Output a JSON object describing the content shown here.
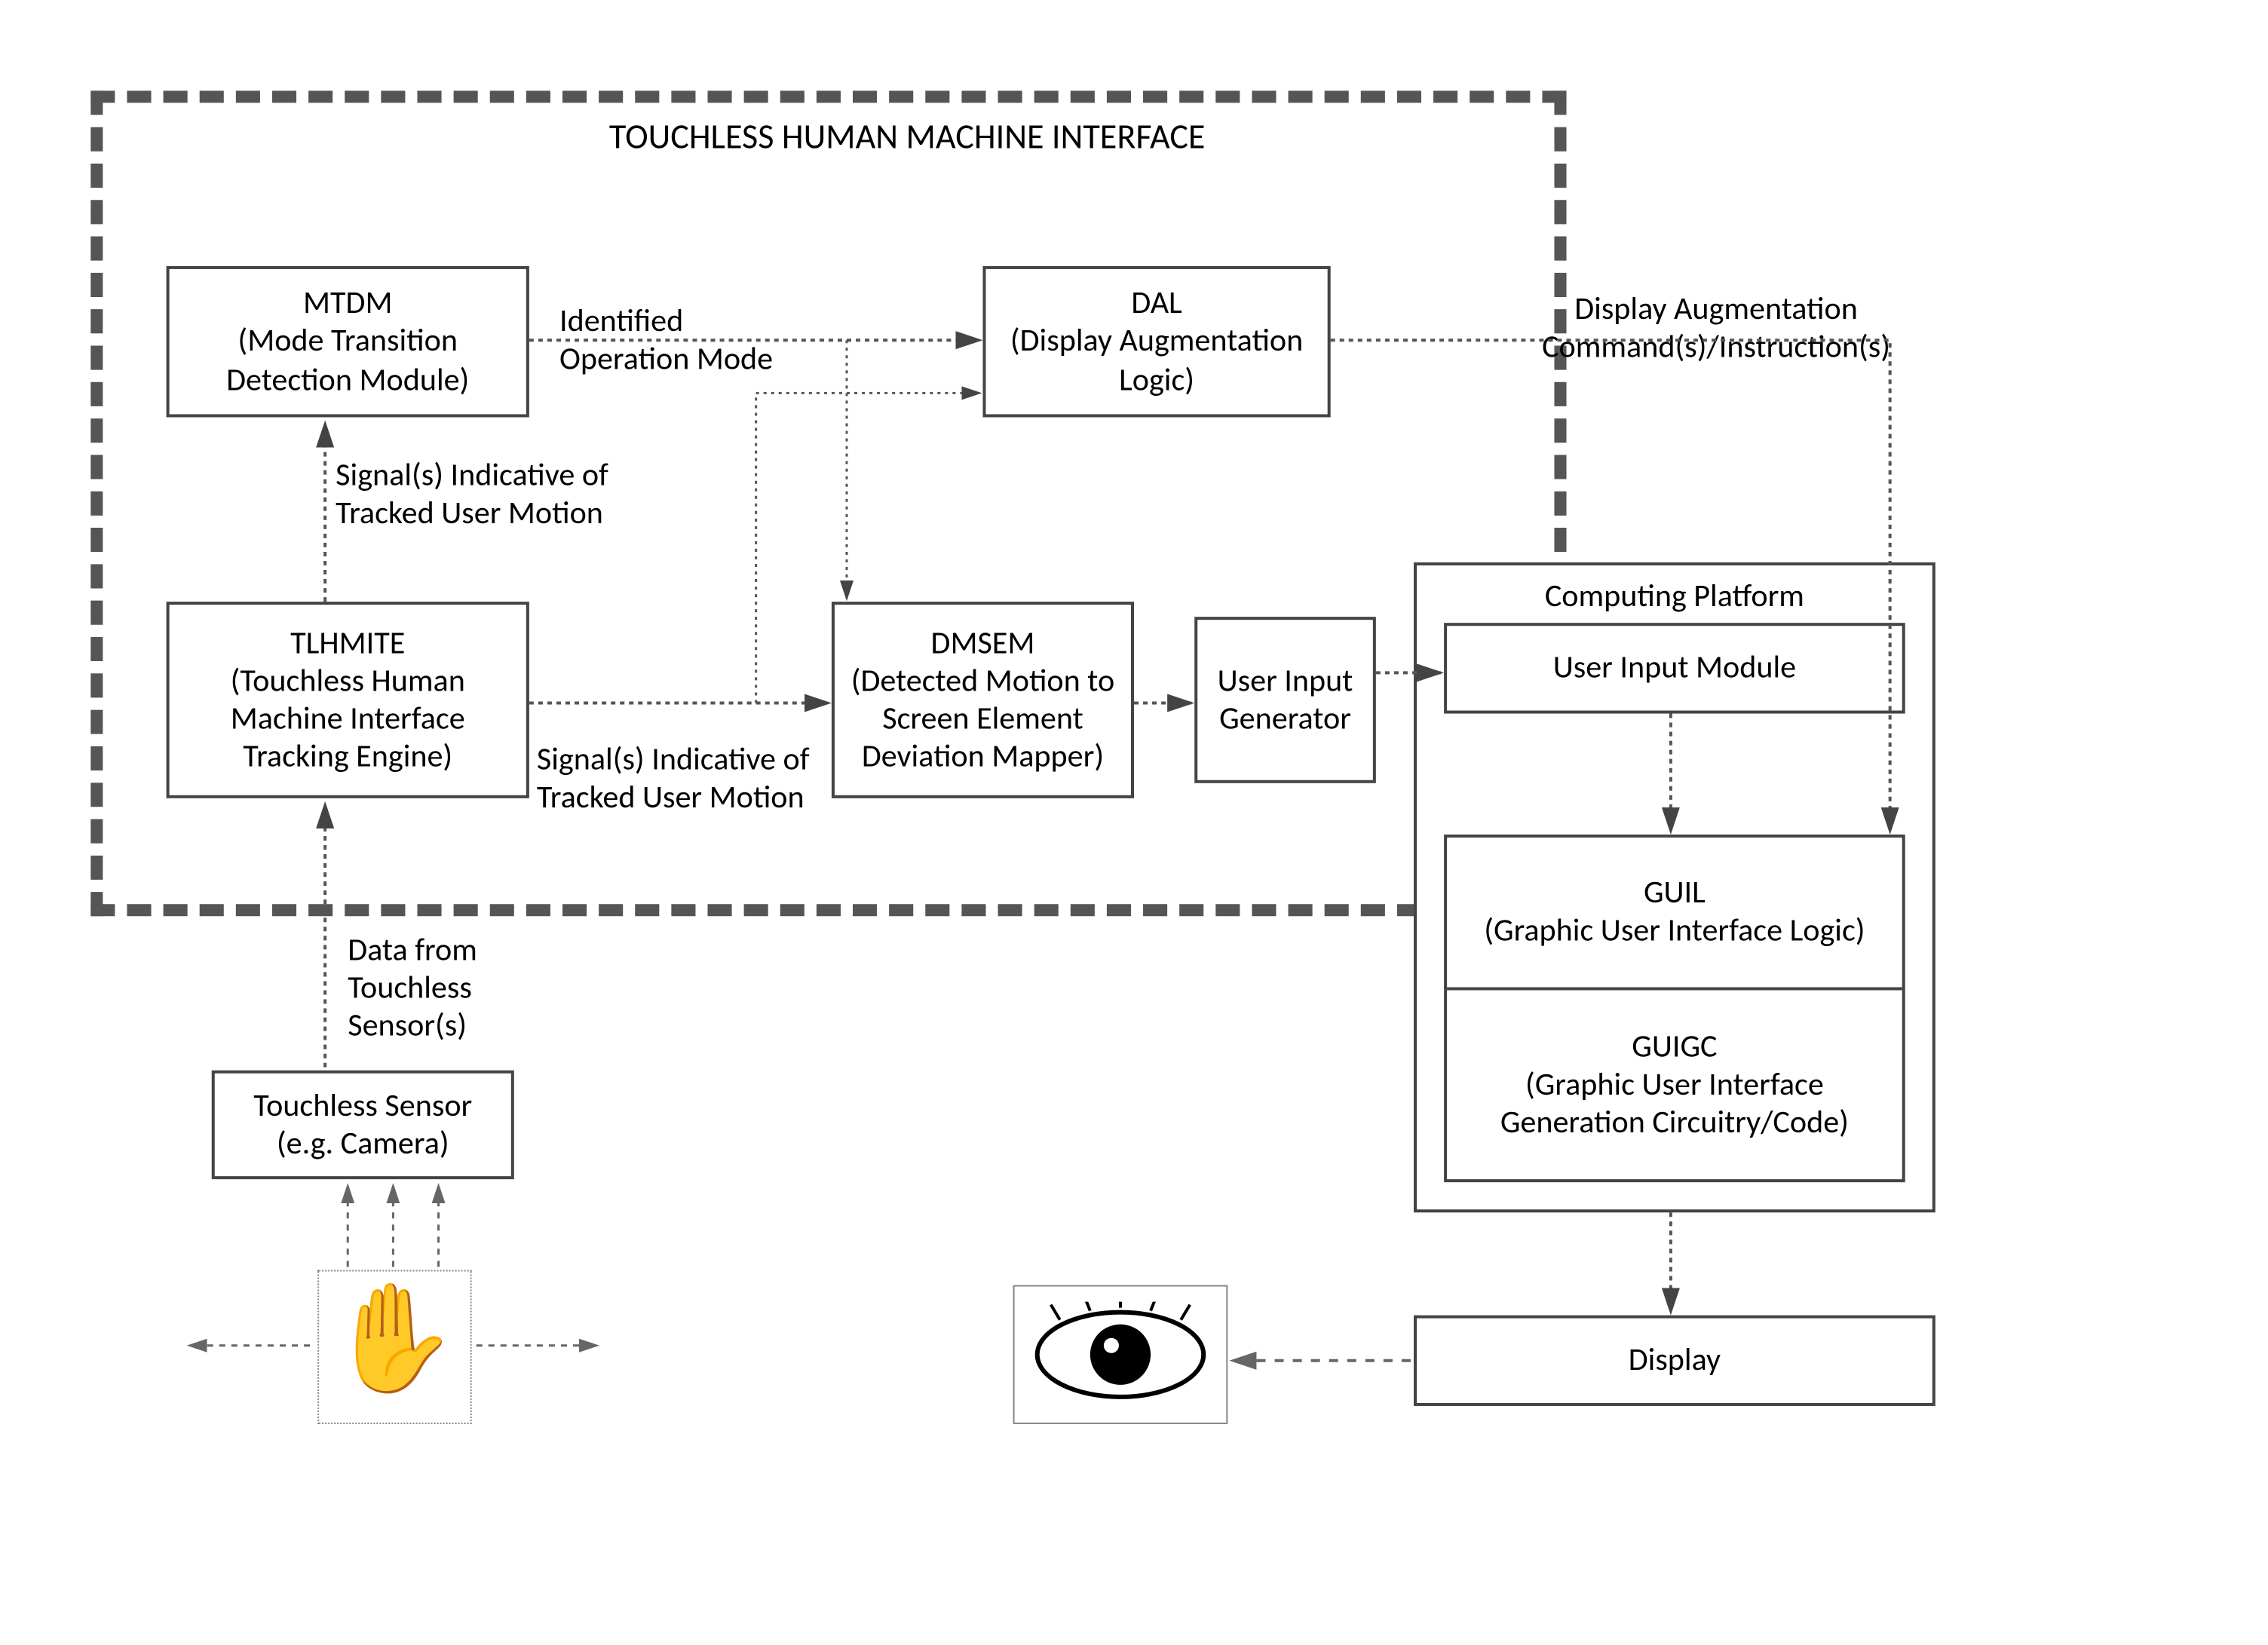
{
  "title": "TOUCHLESS HUMAN MACHINE INTERFACE",
  "boxes": {
    "mtdm": {
      "acronym": "MTDM",
      "full": "(Mode Transition Detection Module)"
    },
    "tlhmite": {
      "acronym": "TLHMITE",
      "full": "(Touchless Human Machine Interface Tracking Engine)"
    },
    "dal": {
      "acronym": "DAL",
      "full": "(Display Augmentation Logic)"
    },
    "dmsem": {
      "acronym": "DMSEM",
      "full": "(Detected Motion to Screen Element Deviation Mapper)"
    },
    "uig": {
      "label": "User Input Generator"
    },
    "computing_platform": {
      "label": "Computing Platform"
    },
    "uim": {
      "label": "User Input Module"
    },
    "guil": {
      "acronym": "GUIL",
      "full": "(Graphic User Interface Logic)"
    },
    "guigc": {
      "acronym": "GUIGC",
      "full": "(Graphic User Interface Generation Circuitry/Code)"
    },
    "display": {
      "label": "Display"
    },
    "sensor": {
      "line1": "Touchless Sensor",
      "line2": "(e.g. Camera)"
    }
  },
  "edge_labels": {
    "identified_mode": "Identified Operation Mode",
    "signals_tracked_user_motion1": "Signal(s) Indicative of  Tracked User Motion",
    "signals_tracked_user_motion2": "Signal(s) Indicative of Tracked User Motion",
    "display_aug_cmds": "Display Augmentation Command(s)/Instruction(s)",
    "data_from_sensor": "Data from Touchless Sensor(s)"
  }
}
